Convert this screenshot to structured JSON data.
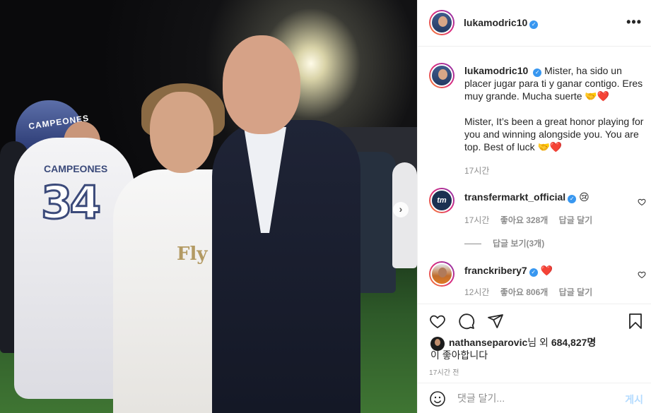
{
  "post": {
    "author": "lukamodric10",
    "verified_mark": "✓"
  },
  "photo": {
    "banner_text": "CAMPEONES",
    "player_name": "CAMPEONES",
    "player_number": "34",
    "shirt_sponsor": "Fly",
    "next_arrow": "›"
  },
  "caption": {
    "username": "lukamodric10",
    "text_es": "Mister, ha sido un placer jugar para ti y ganar contigo. Eres muy grande. Mucha suerte 🤝❤️",
    "text_en": "Mister, It’s been a great honor playing for you and winning alongside you. You are top. Best of luck 🤝❤️",
    "time": "17시간"
  },
  "comments": [
    {
      "username": "transfermarkt_official",
      "avatar_text": "tm",
      "text": "😢",
      "time": "17시간",
      "likes": "좋아요 328개",
      "reply": "답글 달기",
      "view_replies": "답글 보기(3개)"
    },
    {
      "username": "franckribery7",
      "text": "❤️",
      "time": "12시간",
      "likes": "좋아요 806개",
      "reply": "답글 달기"
    }
  ],
  "likes": {
    "liker": "nathanseparovic",
    "mid": "님 외 ",
    "count": "684,827명",
    "suffix": "이 좋아합니다"
  },
  "timestamp": "17시간 전",
  "add_comment": {
    "placeholder": "댓글 달기...",
    "post_label": "게시"
  },
  "icons": {
    "more": "more-options-icon",
    "heart": "heart-icon",
    "comment": "comment-icon",
    "share": "share-icon",
    "save": "bookmark-icon",
    "emoji": "emoji-icon"
  },
  "colors": {
    "verified": "#3897f0",
    "muted": "#8e8e8e",
    "text": "#262626",
    "post_button": "#b3dbff",
    "story_ring_start": "#f58529",
    "story_ring_end": "#8134af"
  }
}
